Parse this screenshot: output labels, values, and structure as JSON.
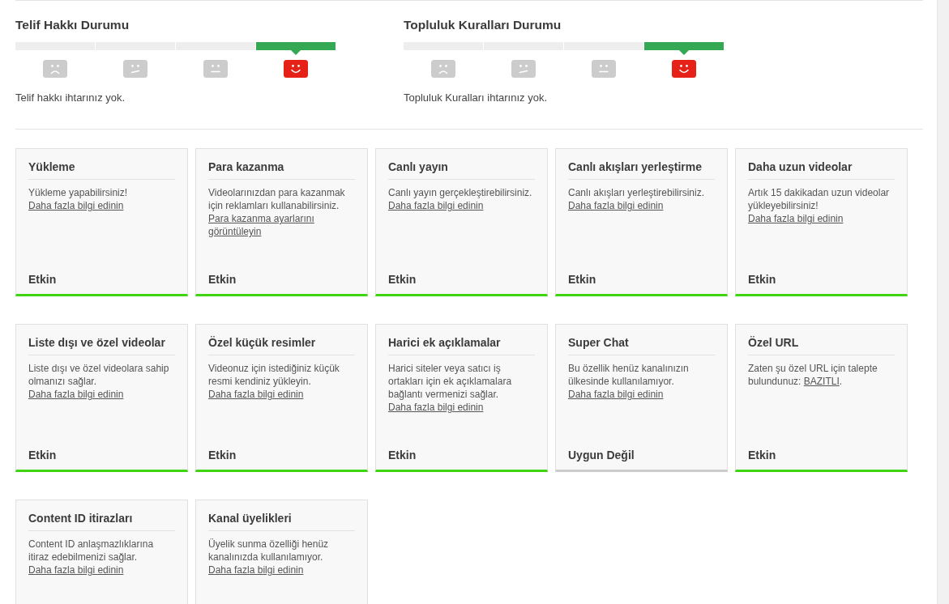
{
  "status_sections": [
    {
      "title": "Telif Hakkı Durumu",
      "levels": [
        {
          "kind": "sad",
          "selected": false
        },
        {
          "kind": "uneasy",
          "selected": false
        },
        {
          "kind": "neutral",
          "selected": false
        },
        {
          "kind": "happy",
          "selected": true
        }
      ],
      "message": "Telif hakkı ihtarınız yok."
    },
    {
      "title": "Topluluk Kuralları Durumu",
      "levels": [
        {
          "kind": "sad",
          "selected": false
        },
        {
          "kind": "uneasy",
          "selected": false
        },
        {
          "kind": "neutral",
          "selected": false
        },
        {
          "kind": "happy",
          "selected": true
        }
      ],
      "message": "Topluluk Kuralları ihtarınız yok."
    }
  ],
  "features": [
    {
      "title": "Yükleme",
      "description": [
        {
          "kind": "text",
          "text": "Yükleme yapabilirsiniz! "
        },
        {
          "kind": "link",
          "text": "Daha fazla bilgi edinin"
        }
      ],
      "status": {
        "kind": "enabled",
        "text": "Etkin"
      }
    },
    {
      "title": "Para kazanma",
      "description": [
        {
          "kind": "text",
          "text": "Videolarınızdan para kazanmak için reklamları kullanabilirsiniz. "
        },
        {
          "kind": "link",
          "text": "Para kazanma ayarlarını görüntüleyin"
        }
      ],
      "status": {
        "kind": "enabled",
        "text": "Etkin"
      }
    },
    {
      "title": "Canlı yayın",
      "description": [
        {
          "kind": "text",
          "text": "Canlı yayın gerçekleştirebilirsiniz. "
        },
        {
          "kind": "link",
          "text": "Daha fazla bilgi edinin"
        }
      ],
      "status": {
        "kind": "enabled",
        "text": "Etkin"
      }
    },
    {
      "title": "Canlı akışları yerleştirme",
      "description": [
        {
          "kind": "text",
          "text": "Canlı akışları yerleştirebilirsiniz. "
        },
        {
          "kind": "link",
          "text": "Daha fazla bilgi edinin"
        }
      ],
      "status": {
        "kind": "enabled",
        "text": "Etkin"
      }
    },
    {
      "title": "Daha uzun videolar",
      "description": [
        {
          "kind": "text",
          "text": "Artık 15 dakikadan uzun videolar yükleyebilirsiniz! "
        },
        {
          "kind": "link",
          "text": "Daha fazla bilgi edinin"
        }
      ],
      "status": {
        "kind": "enabled",
        "text": "Etkin"
      }
    },
    {
      "title": "Liste dışı ve özel videolar",
      "description": [
        {
          "kind": "text",
          "text": "Liste dışı ve özel videolara sahip olmanızı sağlar. "
        },
        {
          "kind": "link",
          "text": "Daha fazla bilgi edinin"
        }
      ],
      "status": {
        "kind": "enabled",
        "text": "Etkin"
      }
    },
    {
      "title": "Özel küçük resimler",
      "description": [
        {
          "kind": "text",
          "text": "Videonuz için istediğiniz küçük resmi kendiniz yükleyin. "
        },
        {
          "kind": "link",
          "text": "Daha fazla bilgi edinin"
        }
      ],
      "status": {
        "kind": "enabled",
        "text": "Etkin"
      }
    },
    {
      "title": "Harici ek açıklamalar",
      "description": [
        {
          "kind": "text",
          "text": "Harici siteler veya satıcı iş ortakları için ek açıklamalara bağlantı vermenizi sağlar. "
        },
        {
          "kind": "link",
          "text": "Daha fazla bilgi edinin"
        }
      ],
      "status": {
        "kind": "enabled",
        "text": "Etkin"
      }
    },
    {
      "title": "Super Chat",
      "description": [
        {
          "kind": "text",
          "text": "Bu özellik henüz kanalınızın ülkesinde kullanılamıyor. "
        },
        {
          "kind": "link",
          "text": "Daha fazla bilgi edinin"
        }
      ],
      "status": {
        "kind": "unavailable",
        "text": "Uygun Değil"
      }
    },
    {
      "title": "Özel URL",
      "description": [
        {
          "kind": "text",
          "text": "Zaten şu özel URL için talepte bulundunuz: "
        },
        {
          "kind": "link",
          "text": "BAZITLI"
        },
        {
          "kind": "text",
          "text": "."
        }
      ],
      "status": {
        "kind": "enabled",
        "text": "Etkin"
      }
    },
    {
      "title": "Content ID itirazları",
      "description": [
        {
          "kind": "text",
          "text": "Content ID anlaşmazlıklarına itiraz edebilmenizi sağlar. "
        },
        {
          "kind": "link",
          "text": "Daha fazla bilgi edinin"
        }
      ]
    },
    {
      "title": "Kanal üyelikleri",
      "description": [
        {
          "kind": "text",
          "text": "Üyelik sunma özelliği henüz kanalınızda kullanılamıyor. "
        },
        {
          "kind": "link",
          "text": "Daha fazla bilgi edinin"
        }
      ]
    }
  ]
}
